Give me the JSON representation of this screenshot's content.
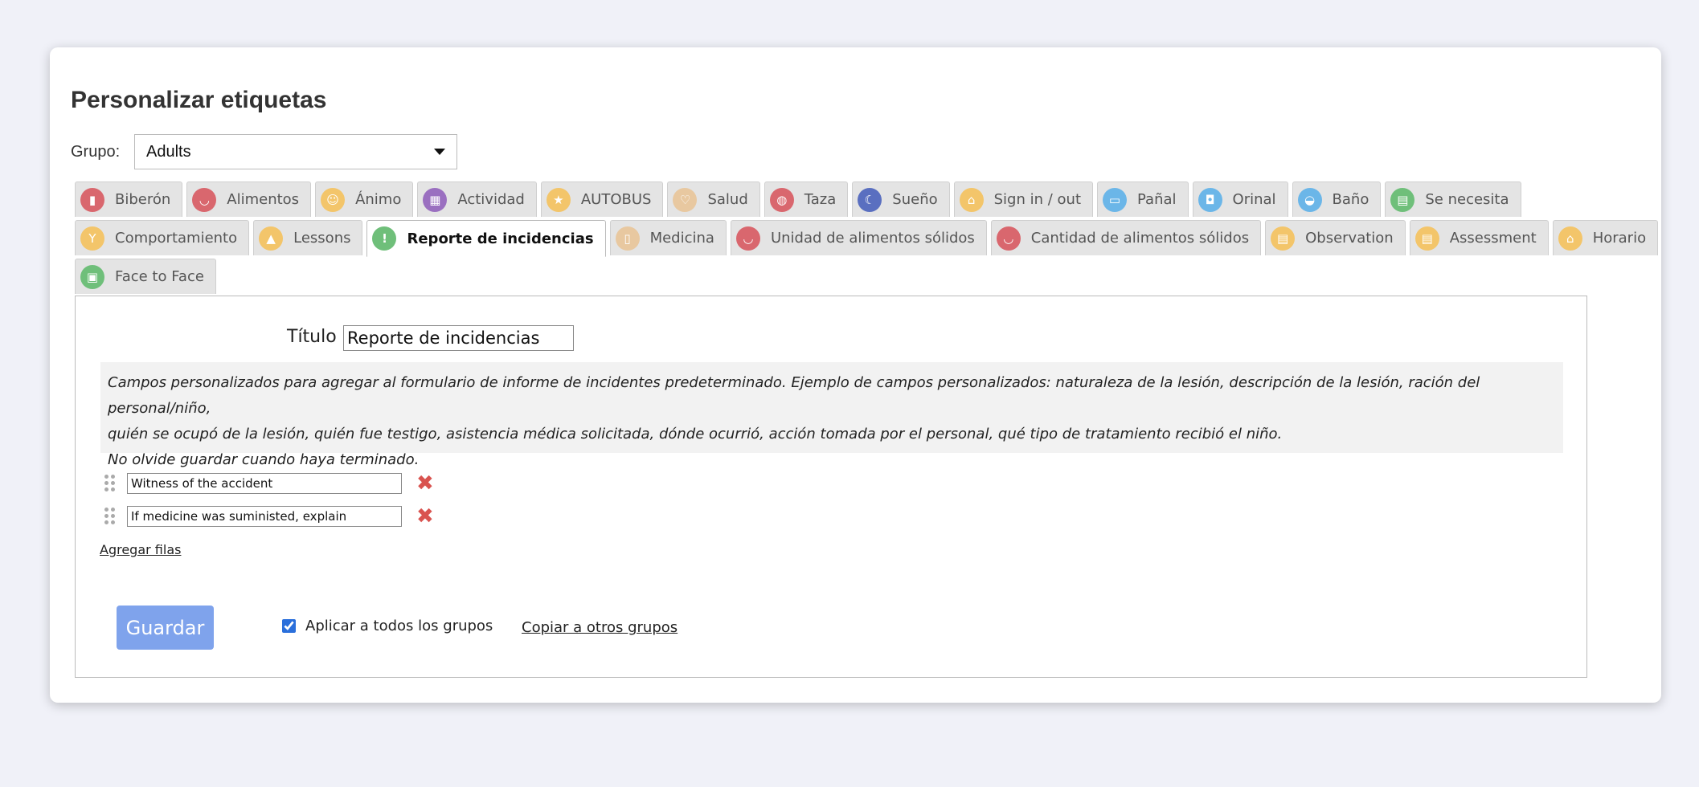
{
  "page": {
    "title": "Personalizar etiquetas"
  },
  "group": {
    "label": "Grupo:",
    "selected": "Adults"
  },
  "tabs_row1": [
    {
      "label": "Biberón",
      "icon": "bottle-icon",
      "color": "#d9676e",
      "glyph": "▮"
    },
    {
      "label": "Alimentos",
      "icon": "bowl-icon",
      "color": "#d9676e",
      "glyph": "◡"
    },
    {
      "label": "Ánimo",
      "icon": "mood-icon",
      "color": "#f3c56a",
      "glyph": "☺"
    },
    {
      "label": "Actividad",
      "icon": "blocks-icon",
      "color": "#9a6fc0",
      "glyph": "▦"
    },
    {
      "label": "AUTOBUS",
      "icon": "star-icon",
      "color": "#f3c56a",
      "glyph": "★"
    },
    {
      "label": "Salud",
      "icon": "stethoscope-icon",
      "color": "#e8c8a0",
      "glyph": "♡"
    },
    {
      "label": "Taza",
      "icon": "cup-icon",
      "color": "#d9676e",
      "glyph": "◍"
    },
    {
      "label": "Sueño",
      "icon": "moon-icon",
      "color": "#5a6fc0",
      "glyph": "☾"
    },
    {
      "label": "Sign in / out",
      "icon": "home-icon",
      "color": "#f3c56a",
      "glyph": "⌂"
    },
    {
      "label": "Pañal",
      "icon": "diaper-icon",
      "color": "#6bb6e8",
      "glyph": "▭"
    },
    {
      "label": "Orinal",
      "icon": "potty-icon",
      "color": "#6bb6e8",
      "glyph": "◘"
    },
    {
      "label": "Baño",
      "icon": "bath-icon",
      "color": "#6bb6e8",
      "glyph": "◒"
    },
    {
      "label": "Se necesita",
      "icon": "clipboard-icon",
      "color": "#6fbf7a",
      "glyph": "▤"
    }
  ],
  "tabs_row2": [
    {
      "label": "Comportamiento",
      "icon": "behavior-icon",
      "color": "#f3c56a",
      "glyph": "Y"
    },
    {
      "label": "Lessons",
      "icon": "graduation-cap-icon",
      "color": "#f3c56a",
      "glyph": "▲"
    },
    {
      "label": "Reporte de incidencias",
      "icon": "warning-icon",
      "color": "#6fbf7a",
      "glyph": "!",
      "active": true
    },
    {
      "label": "Medicina",
      "icon": "medicine-icon",
      "color": "#e8c8a0",
      "glyph": "▯"
    },
    {
      "label": "Unidad de alimentos sólidos",
      "icon": "bowl-icon",
      "color": "#d9676e",
      "glyph": "◡"
    },
    {
      "label": "Cantidad de alimentos sólidos",
      "icon": "bowl-icon",
      "color": "#d9676e",
      "glyph": "◡"
    },
    {
      "label": "Observation",
      "icon": "note-icon",
      "color": "#f3c56a",
      "glyph": "▤"
    },
    {
      "label": "Assessment",
      "icon": "note-icon",
      "color": "#f3c56a",
      "glyph": "▤"
    },
    {
      "label": "Horario",
      "icon": "home-icon",
      "color": "#f3c56a",
      "glyph": "⌂"
    }
  ],
  "tabs_row3": [
    {
      "label": "Face to Face",
      "icon": "face-to-face-icon",
      "color": "#6fbf7a",
      "glyph": "▣"
    }
  ],
  "form": {
    "title_label": "Título",
    "title_value": "Reporte de incidencias",
    "info_lines": [
      "Campos personalizados para agregar al formulario de informe de incidentes predeterminado. Ejemplo de campos personalizados: naturaleza de la lesión, descripción de la lesión, ración del personal/niño,",
      "quién se ocupó de la lesión, quién fue testigo, asistencia médica solicitada, dónde ocurrió, acción tomada por el personal, qué tipo de tratamiento recibió el niño.",
      "No olvide guardar cuando haya terminado."
    ],
    "rows": [
      "Witness of the accident",
      "If medicine was suministed, explain"
    ],
    "add_rows": "Agregar filas"
  },
  "footer": {
    "save": "Guardar",
    "apply_all": "Aplicar a todos los grupos",
    "apply_all_checked": true,
    "copy": "Copiar a otros grupos"
  }
}
